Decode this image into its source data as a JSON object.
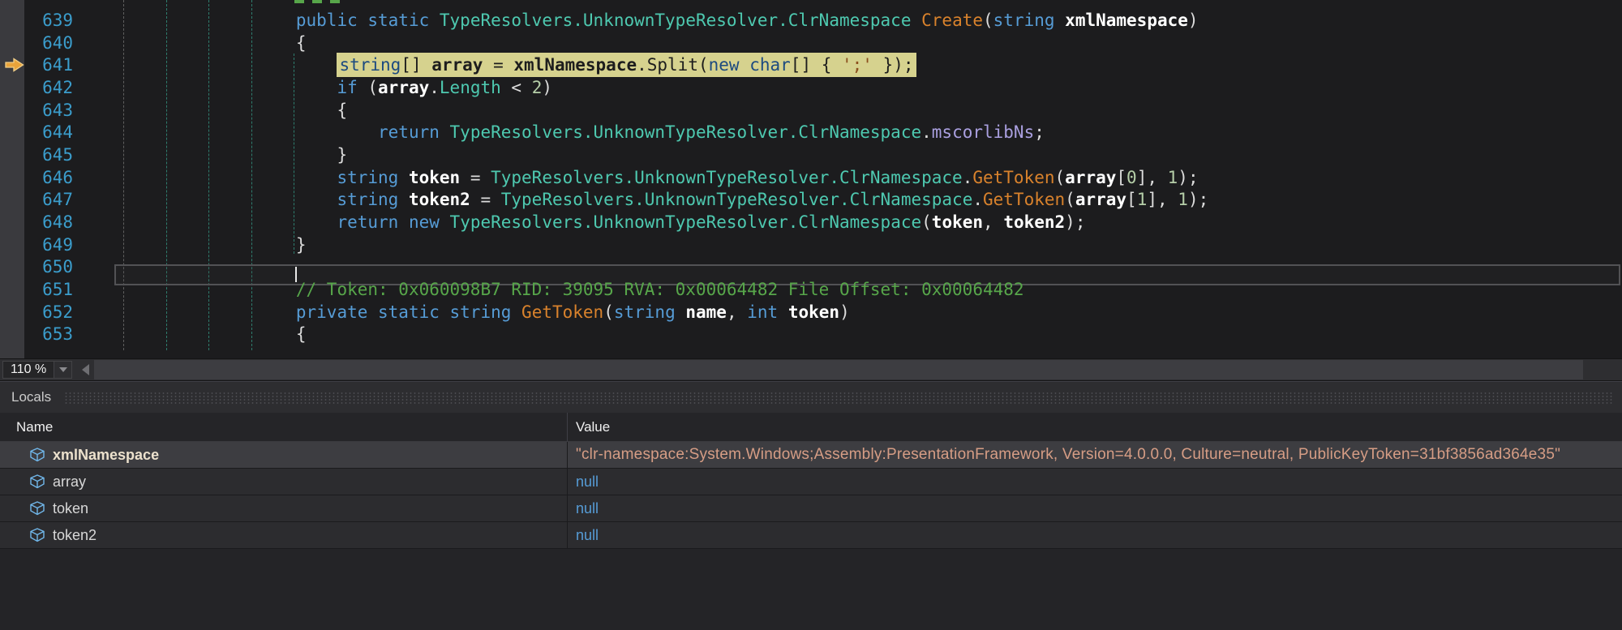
{
  "editor": {
    "zoom_level": "110 %",
    "current_statement_line": "641",
    "caret_line": "650",
    "lines": [
      {
        "n": "639",
        "indent": 20,
        "segs": [
          {
            "c": "kw",
            "t": "public static "
          },
          {
            "c": "ty",
            "t": "TypeResolvers.UnknownTypeResolver.ClrNamespace"
          },
          {
            "c": "pl",
            "t": " "
          },
          {
            "c": "me",
            "t": "Create"
          },
          {
            "c": "pl",
            "t": "("
          },
          {
            "c": "kw",
            "t": "string"
          },
          {
            "c": "pl",
            "t": " "
          },
          {
            "c": "id",
            "t": "xmlNamespace"
          },
          {
            "c": "pl",
            "t": ")"
          }
        ]
      },
      {
        "n": "640",
        "indent": 20,
        "segs": [
          {
            "c": "pl",
            "t": "{"
          }
        ]
      },
      {
        "n": "641",
        "indent": 24,
        "hl": true,
        "segs": [
          {
            "c": "kwd",
            "t": "string"
          },
          {
            "c": "pld",
            "t": "[] "
          },
          {
            "c": "idd",
            "t": "array"
          },
          {
            "c": "pld",
            "t": " = "
          },
          {
            "c": "idd",
            "t": "xmlNamespace"
          },
          {
            "c": "pld",
            "t": ".Split("
          },
          {
            "c": "kwd",
            "t": "new"
          },
          {
            "c": "pld",
            "t": " "
          },
          {
            "c": "kwd",
            "t": "char"
          },
          {
            "c": "pld",
            "t": "[] { "
          },
          {
            "c": "strd",
            "t": "';'"
          },
          {
            "c": "pld",
            "t": " });"
          }
        ]
      },
      {
        "n": "642",
        "indent": 24,
        "segs": [
          {
            "c": "kw",
            "t": "if"
          },
          {
            "c": "pl",
            "t": " ("
          },
          {
            "c": "id",
            "t": "array"
          },
          {
            "c": "pl",
            "t": "."
          },
          {
            "c": "prop",
            "t": "Length"
          },
          {
            "c": "pl",
            "t": " < "
          },
          {
            "c": "num",
            "t": "2"
          },
          {
            "c": "pl",
            "t": ")"
          }
        ]
      },
      {
        "n": "643",
        "indent": 24,
        "segs": [
          {
            "c": "pl",
            "t": "{"
          }
        ]
      },
      {
        "n": "644",
        "indent": 28,
        "segs": [
          {
            "c": "kw",
            "t": "return"
          },
          {
            "c": "pl",
            "t": " "
          },
          {
            "c": "ty",
            "t": "TypeResolvers.UnknownTypeResolver.ClrNamespace"
          },
          {
            "c": "pl",
            "t": "."
          },
          {
            "c": "fld",
            "t": "mscorlibNs"
          },
          {
            "c": "pl",
            "t": ";"
          }
        ]
      },
      {
        "n": "645",
        "indent": 24,
        "segs": [
          {
            "c": "pl",
            "t": "}"
          }
        ]
      },
      {
        "n": "646",
        "indent": 24,
        "segs": [
          {
            "c": "kw",
            "t": "string"
          },
          {
            "c": "pl",
            "t": " "
          },
          {
            "c": "id",
            "t": "token"
          },
          {
            "c": "pl",
            "t": " = "
          },
          {
            "c": "ty",
            "t": "TypeResolvers.UnknownTypeResolver.ClrNamespace"
          },
          {
            "c": "pl",
            "t": "."
          },
          {
            "c": "me",
            "t": "GetToken"
          },
          {
            "c": "pl",
            "t": "("
          },
          {
            "c": "id",
            "t": "array"
          },
          {
            "c": "pl",
            "t": "["
          },
          {
            "c": "num",
            "t": "0"
          },
          {
            "c": "pl",
            "t": "], "
          },
          {
            "c": "num",
            "t": "1"
          },
          {
            "c": "pl",
            "t": ");"
          }
        ]
      },
      {
        "n": "647",
        "indent": 24,
        "segs": [
          {
            "c": "kw",
            "t": "string"
          },
          {
            "c": "pl",
            "t": " "
          },
          {
            "c": "id",
            "t": "token2"
          },
          {
            "c": "pl",
            "t": " = "
          },
          {
            "c": "ty",
            "t": "TypeResolvers.UnknownTypeResolver.ClrNamespace"
          },
          {
            "c": "pl",
            "t": "."
          },
          {
            "c": "me",
            "t": "GetToken"
          },
          {
            "c": "pl",
            "t": "("
          },
          {
            "c": "id",
            "t": "array"
          },
          {
            "c": "pl",
            "t": "["
          },
          {
            "c": "num",
            "t": "1"
          },
          {
            "c": "pl",
            "t": "], "
          },
          {
            "c": "num",
            "t": "1"
          },
          {
            "c": "pl",
            "t": ");"
          }
        ]
      },
      {
        "n": "648",
        "indent": 24,
        "segs": [
          {
            "c": "kw",
            "t": "return"
          },
          {
            "c": "pl",
            "t": " "
          },
          {
            "c": "kw",
            "t": "new"
          },
          {
            "c": "pl",
            "t": " "
          },
          {
            "c": "ty",
            "t": "TypeResolvers.UnknownTypeResolver.ClrNamespace"
          },
          {
            "c": "pl",
            "t": "("
          },
          {
            "c": "id",
            "t": "token"
          },
          {
            "c": "pl",
            "t": ", "
          },
          {
            "c": "id",
            "t": "token2"
          },
          {
            "c": "pl",
            "t": ");"
          }
        ]
      },
      {
        "n": "649",
        "indent": 20,
        "segs": [
          {
            "c": "pl",
            "t": "}"
          }
        ]
      },
      {
        "n": "650",
        "indent": 0,
        "segs": []
      },
      {
        "n": "651",
        "indent": 20,
        "segs": [
          {
            "c": "cm",
            "t": "// Token: 0x060098B7 RID: 39095 RVA: 0x00064482 File Offset: 0x00064482"
          }
        ]
      },
      {
        "n": "652",
        "indent": 20,
        "segs": [
          {
            "c": "kw",
            "t": "private static string"
          },
          {
            "c": "pl",
            "t": " "
          },
          {
            "c": "me",
            "t": "GetToken"
          },
          {
            "c": "pl",
            "t": "("
          },
          {
            "c": "kw",
            "t": "string"
          },
          {
            "c": "pl",
            "t": " "
          },
          {
            "c": "id",
            "t": "name"
          },
          {
            "c": "pl",
            "t": ", "
          },
          {
            "c": "kw",
            "t": "int"
          },
          {
            "c": "pl",
            "t": " "
          },
          {
            "c": "id",
            "t": "token"
          },
          {
            "c": "pl",
            "t": ")"
          }
        ]
      },
      {
        "n": "653",
        "indent": 20,
        "segs": [
          {
            "c": "pl",
            "t": "{"
          }
        ]
      }
    ]
  },
  "locals": {
    "title": "Locals",
    "columns": [
      "Name",
      "Value"
    ],
    "rows": [
      {
        "name": "xmlNamespace",
        "value": "\"clr-namespace:System.Windows;Assembly:PresentationFramework, Version=4.0.0.0, Culture=neutral, PublicKeyToken=31bf3856ad364e35\""
      },
      {
        "name": "array",
        "value": "null"
      },
      {
        "name": "token",
        "value": "null"
      },
      {
        "name": "token2",
        "value": "null"
      }
    ]
  },
  "colors": {
    "highlight_yellow": "#d6d28e",
    "exec_arrow": "#e8a33b",
    "keyword_blue": "#569cd6",
    "type_teal": "#4ec9b0",
    "method_orange": "#d9822c",
    "comment_green": "#57a64a",
    "string_salmon": "#d69d85",
    "line_number": "#3b9dcc"
  }
}
